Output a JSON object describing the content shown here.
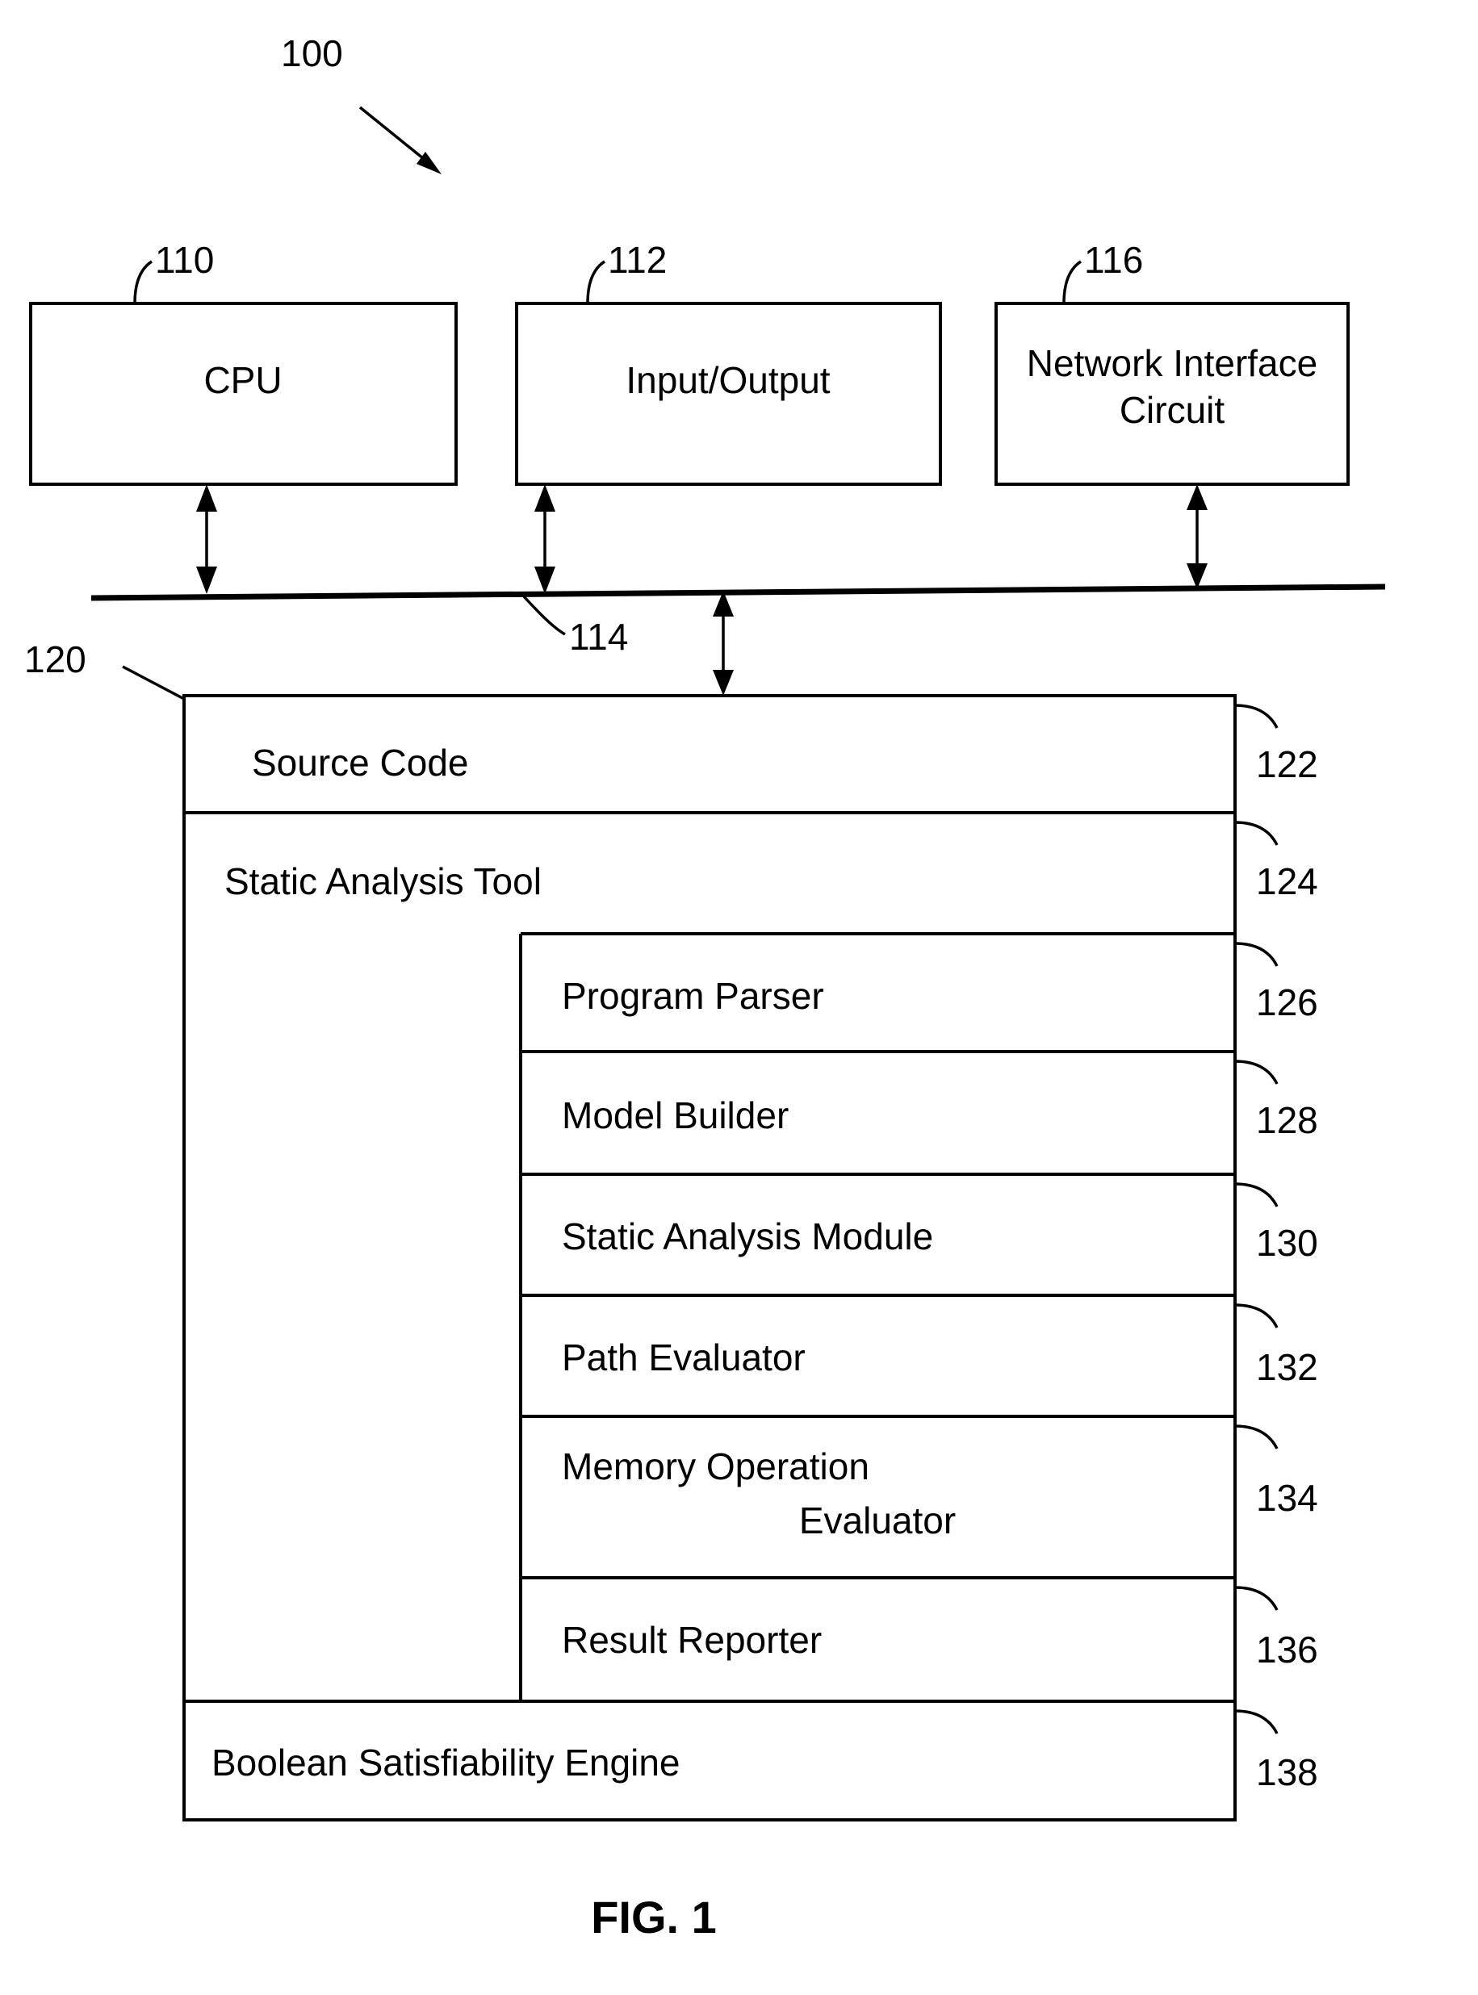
{
  "figure": {
    "caption": "FIG. 1",
    "system_ref": "100"
  },
  "hardware": {
    "boxes": [
      {
        "label": "CPU",
        "ref": "110"
      },
      {
        "label": "Input/Output",
        "ref": "112"
      },
      {
        "label": "Network Interface Circuit",
        "ref": "116"
      }
    ],
    "bus": {
      "ref": "114"
    }
  },
  "memory": {
    "ref": "120",
    "rows": [
      {
        "label": "Source Code",
        "ref": "122"
      },
      {
        "label": "Static Analysis Tool",
        "ref": "124"
      },
      {
        "label": "Boolean Satisfiability Engine",
        "ref": "138"
      }
    ],
    "modules": [
      {
        "label": "Program Parser",
        "ref": "126"
      },
      {
        "label": "Model Builder",
        "ref": "128"
      },
      {
        "label": "Static Analysis Module",
        "ref": "130"
      },
      {
        "label": "Path Evaluator",
        "ref": "132"
      },
      {
        "label": "Memory Operation Evaluator",
        "ref": "134",
        "line1": "Memory Operation",
        "line2": "Evaluator"
      },
      {
        "label": "Result Reporter",
        "ref": "136"
      }
    ]
  },
  "colors": {
    "ink": "#000000",
    "paper": "#ffffff"
  }
}
